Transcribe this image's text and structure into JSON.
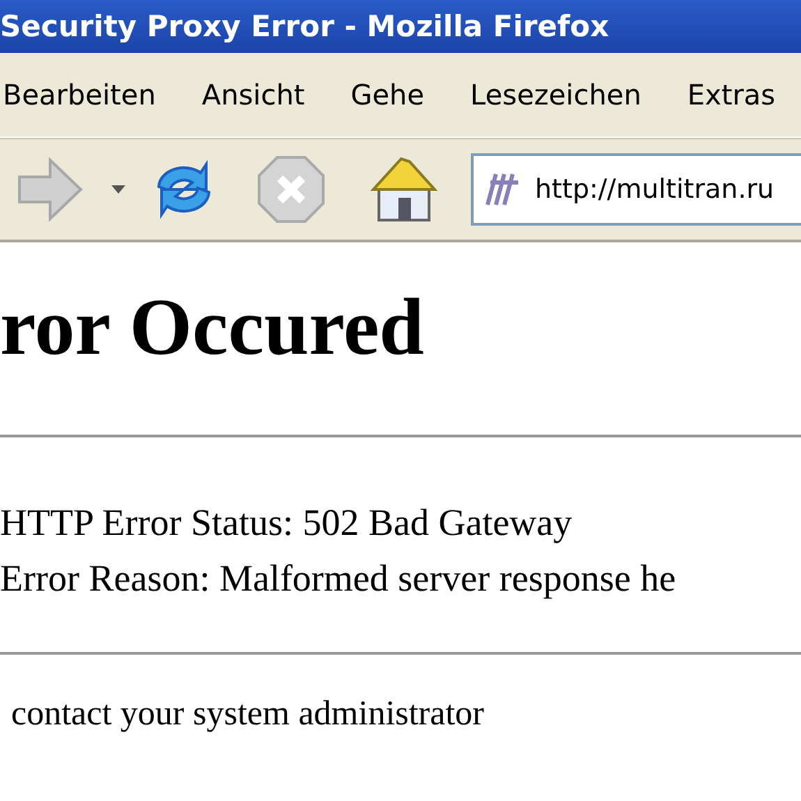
{
  "window": {
    "title": "Security Proxy Error - Mozilla Firefox"
  },
  "menu": [
    {
      "label": "Bearbeiten"
    },
    {
      "label": "Ansicht"
    },
    {
      "label": "Gehe"
    },
    {
      "label": "Lesezeichen"
    },
    {
      "label": "Extras"
    }
  ],
  "toolbar": [
    {
      "kind": "forward",
      "disabled": true
    },
    {
      "kind": "dropdown",
      "disabled": false
    },
    {
      "kind": "reload",
      "disabled": false
    },
    {
      "kind": "stop",
      "disabled": true
    },
    {
      "kind": "home",
      "disabled": false
    }
  ],
  "address_bar": {
    "value": "http://multitran.ru"
  },
  "page": {
    "heading": "ror Occured",
    "details": [
      "HTTP Error Status: 502 Bad Gateway",
      "Error Reason: Malformed server response he"
    ],
    "footer": "contact your system administrator"
  }
}
